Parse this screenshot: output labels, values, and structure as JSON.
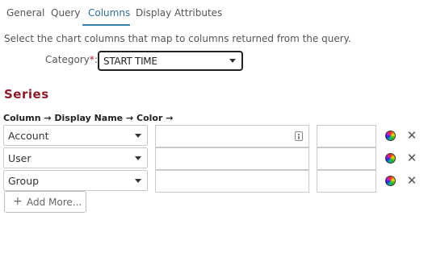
{
  "tabs": [
    {
      "label": "General"
    },
    {
      "label": "Query"
    },
    {
      "label": "Columns",
      "active": true
    },
    {
      "label": "Display Attributes"
    }
  ],
  "instructions": "Select the chart columns that map to columns returned from the query.",
  "category": {
    "label": "Category",
    "required_marker": "*",
    "separator": ":",
    "value": "START TIME"
  },
  "series": {
    "title": "Series",
    "column_header": "Column → Display Name → Color →",
    "rows": [
      {
        "column": "Account",
        "display_name": "",
        "color": ""
      },
      {
        "column": "User",
        "display_name": "",
        "color": ""
      },
      {
        "column": "Group",
        "display_name": "",
        "color": ""
      }
    ],
    "remove_glyph": "✕",
    "add_more": {
      "icon": "+",
      "label": "Add More..."
    }
  },
  "icons": {
    "field_icon": "info-card-icon",
    "palette_icon": "color-wheel-icon",
    "remove_icon": "close-icon",
    "caret_icon": "chevron-down-icon"
  },
  "colors": {
    "accent": "#3a7fa8",
    "required": "#b01c2e",
    "section_title": "#8b1a2b"
  }
}
